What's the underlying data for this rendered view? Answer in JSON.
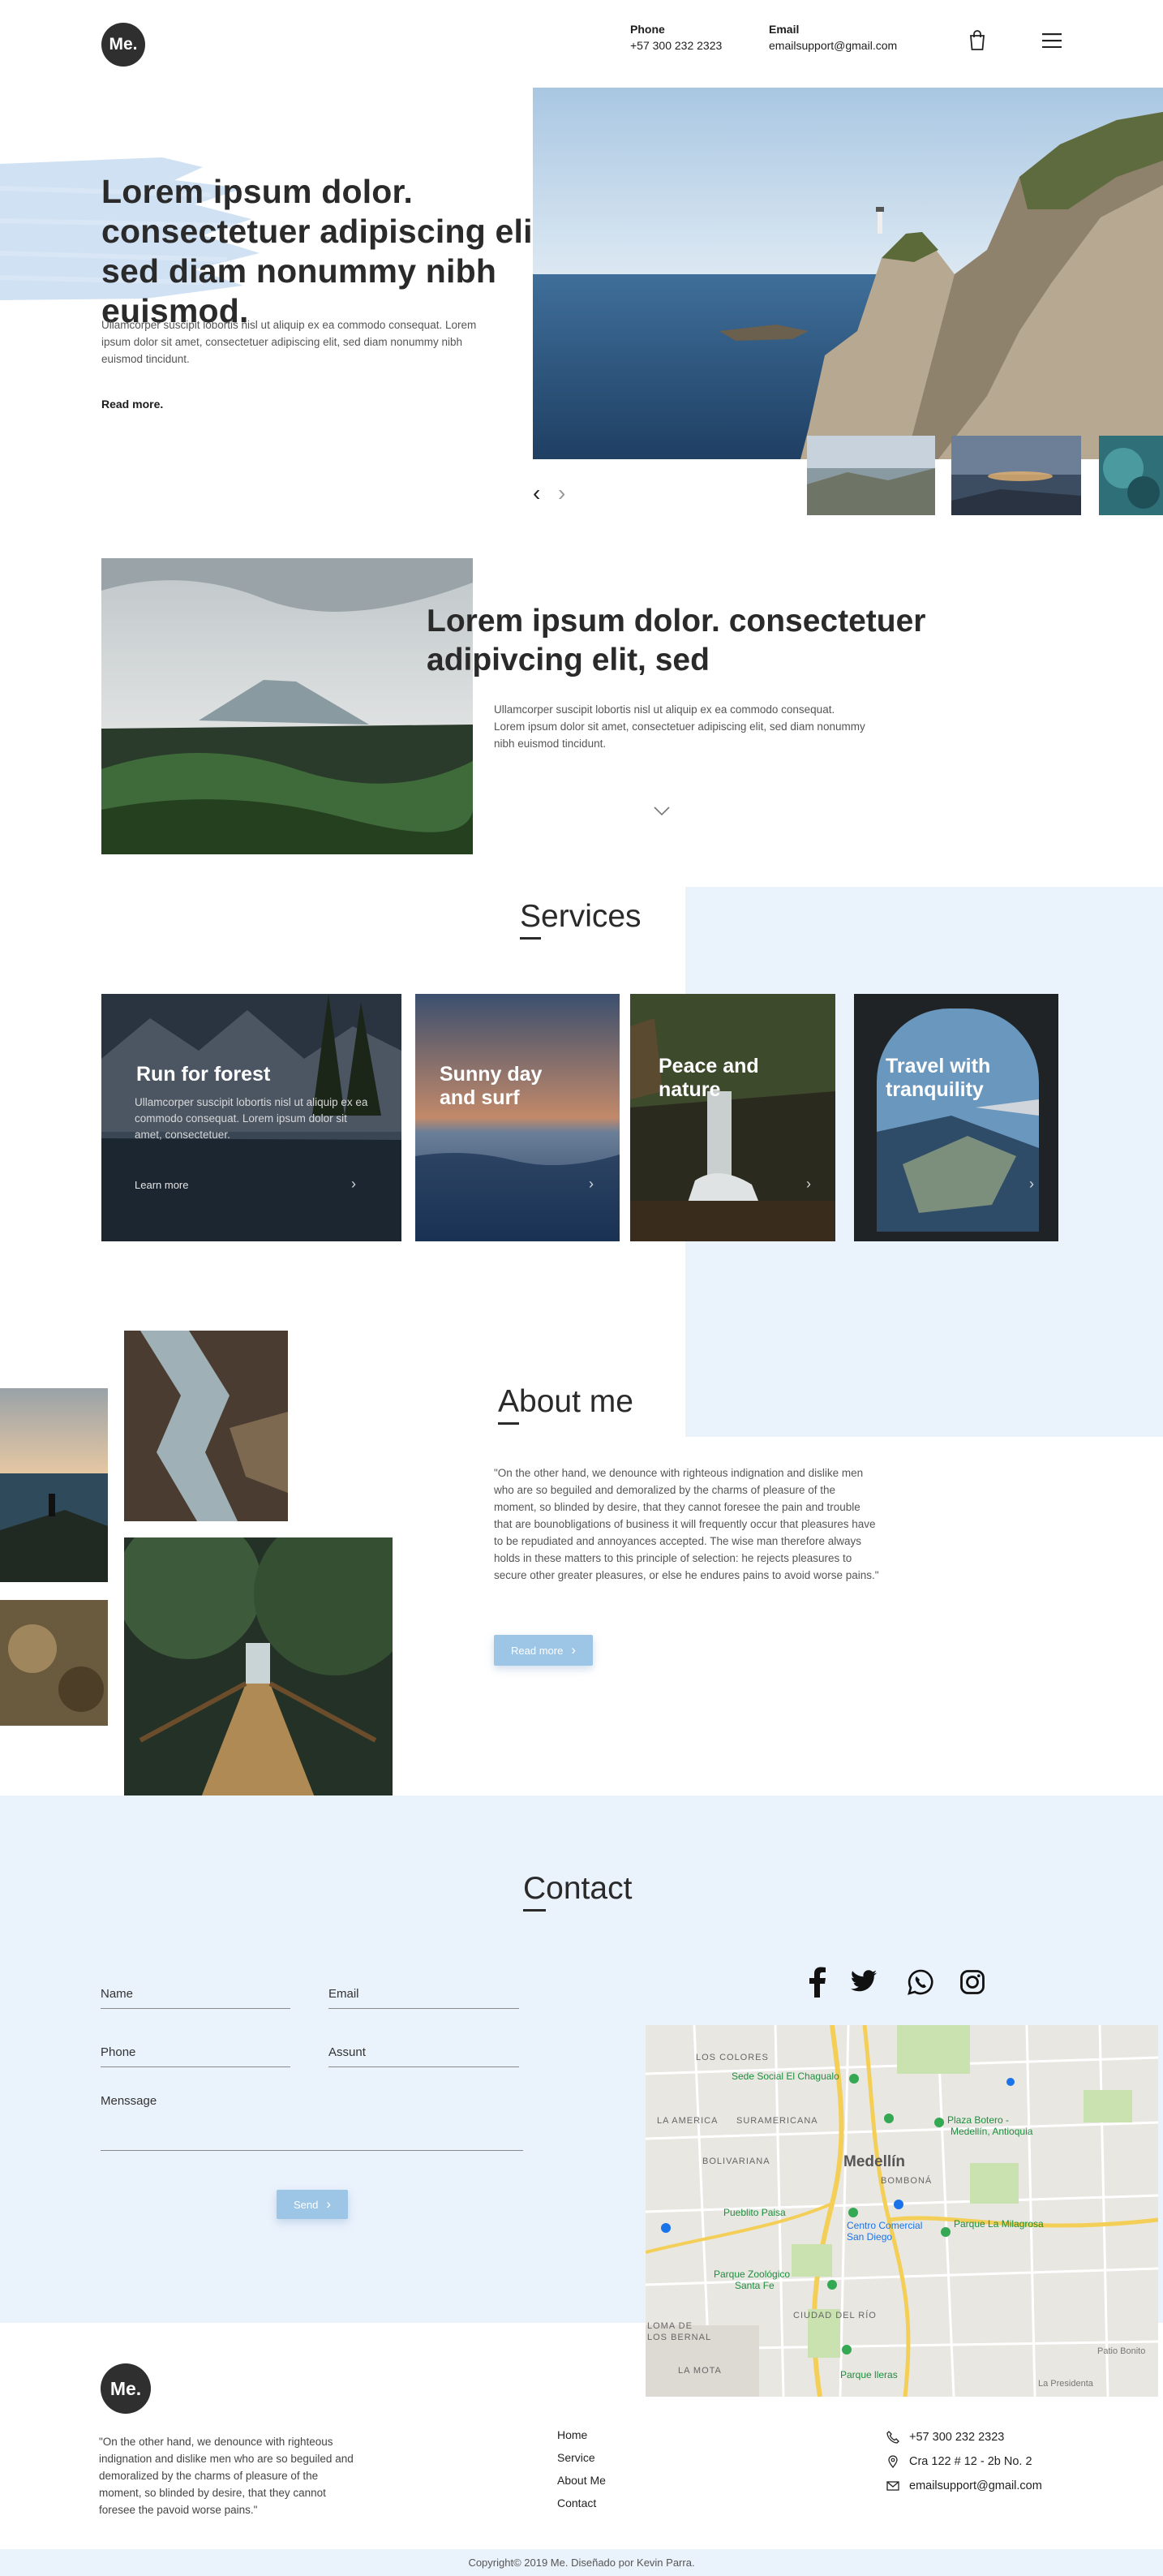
{
  "header": {
    "logo_text": "Me.",
    "phone_label": "Phone",
    "phone_value": "+57 300 232 2323",
    "email_label": "Email",
    "email_value": "emailsupport@gmail.com",
    "cart_icon": "shopping-bag-icon",
    "menu_icon": "hamburger-menu-icon"
  },
  "hero": {
    "title": "Lorem ipsum dolor. consectetuer adipiscing elit, sed diam nonummy nibh euismod.",
    "text": "Ullamcorper suscipit lobortis nisl ut aliquip ex ea commodo consequat. Lorem ipsum dolor sit amet, consectetuer adipiscing elit, sed diam nonummy nibh euismod tincidunt.",
    "read_more": "Read more.",
    "prev_arrow": "‹",
    "next_arrow": "›"
  },
  "intro": {
    "title": "Lorem ipsum dolor. consectetuer adipivcing elit, sed",
    "text": "Ullamcorper suscipit lobortis nisl ut aliquip ex ea commodo consequat. Lorem ipsum dolor sit amet, consectetuer adipiscing elit, sed diam nonummy nibh euismod tincidunt.",
    "scroll_icon": "chevron-down-icon"
  },
  "services": {
    "title_first": "S",
    "title_rest": "ervices",
    "cards": [
      {
        "title": "Run for forest",
        "text": "Ullamcorper suscipit lobortis nisl ut aliquip ex ea commodo consequat. Lorem ipsum dolor sit amet, consectetuer.",
        "link": "Learn more",
        "arrow": "›"
      },
      {
        "title": "Sunny day and surf",
        "arrow": "›"
      },
      {
        "title": "Peace and nature",
        "arrow": "›"
      },
      {
        "title": "Travel with tranquility",
        "arrow": "›"
      }
    ]
  },
  "about": {
    "title_first": "A",
    "title_rest": "bout me",
    "text": "\"On the other hand, we denounce with righteous indignation and dislike men who are so beguiled and demoralized by the charms of pleasure of the moment, so blinded by desire, that they cannot foresee the pain and trouble that are bounobligations of business it will frequently occur that pleasures have to be repudiated and annoyances accepted. The wise man therefore always holds in these matters to this principle of selection: he rejects pleasures to secure other greater pleasures, or else he endures pains to avoid worse pains.\"",
    "button": "Read more",
    "button_arrow": "›"
  },
  "contact": {
    "title_first": "C",
    "title_rest": "ontact",
    "fields": {
      "name": "Name",
      "email": "Email",
      "phone": "Phone",
      "assunt": "Assunt",
      "message": "Menssage"
    },
    "send": "Send",
    "send_arrow": "›",
    "social": [
      "facebook-icon",
      "twitter-icon",
      "whatsapp-icon",
      "instagram-icon"
    ],
    "map": {
      "labels": {
        "los_colores": "LOS COLORES",
        "sede_social": "Sede Social El Chagualo",
        "la_america": "LA AMERICA",
        "suramericana": "SURAMERICANA",
        "plaza_botero": "Plaza Botero -",
        "plaza_botero_2": "Medellín, Antioquia",
        "bolivariana": "BOLIVARIANA",
        "medellin": "Medellín",
        "bomboná": "BOMBONÁ",
        "pueblito_paisa": "Pueblito Paisa",
        "centro_comercial": "Centro Comercial",
        "san_diego": "San Diego",
        "parque_la_milagrosa": "Parque La Milagrosa",
        "parque_zoologico": "Parque Zoológico",
        "santa_fe": "Santa Fe",
        "loma_de_los_bernal": "LOMA DE LOS BERNAL",
        "ciudad_del_rio": "CIUDAD DEL RÍO",
        "la_mota": "LA MOTA",
        "parque_lleras": "Parque lleras",
        "la_presidenta": "La Presidenta",
        "patio_bonito": "Patio Bonito"
      }
    }
  },
  "footer": {
    "logo_text": "Me.",
    "quote": "\"On the other hand, we denounce with righteous indignation and dislike men who are so beguiled and demoralized by the charms of pleasure of the moment, so blinded by desire, that they cannot foresee the pavoid worse pains.\"",
    "links": [
      "Home",
      "Service",
      "About Me",
      "Contact"
    ],
    "phone": "+57 300 232 2323",
    "address": "Cra 122 # 12 - 2b No. 2",
    "email": "emailsupport@gmail.com",
    "copyright": "Copyright© 2019 Me. Diseñado por Kevin Parra."
  },
  "colors": {
    "accent_light": "#eaf2fc",
    "button_blue": "#9cc5e6",
    "dark": "#2f2f2f"
  }
}
